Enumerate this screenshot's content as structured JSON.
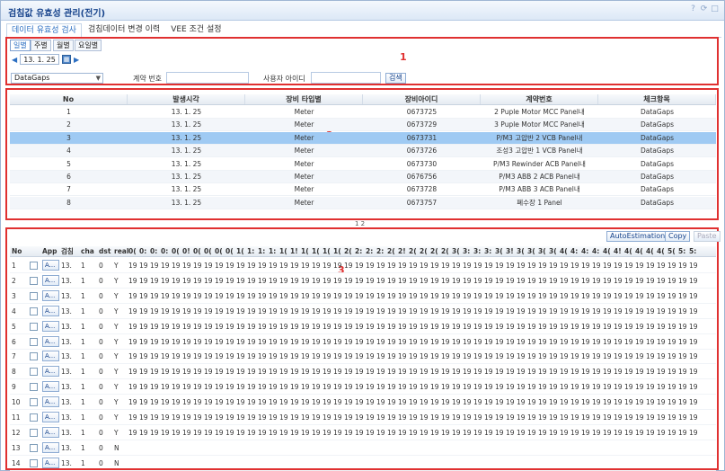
{
  "window": {
    "title": "검침값 유효성 관리(전기)"
  },
  "tabs": [
    {
      "label": "데이터 유효성 검사"
    },
    {
      "label": "검침데이터 변경 이력"
    },
    {
      "label": "VEE 조건 설정"
    }
  ],
  "section1": {
    "number": "1",
    "period_buttons": [
      "일별",
      "주별",
      "월별",
      "요일별"
    ],
    "date": "13. 1. 25",
    "check_select": "DataGaps",
    "contract_label": "계약 번호",
    "contract_value": "",
    "user_label": "사용자 아이디",
    "user_value": "",
    "search_label": "검색"
  },
  "section2": {
    "number": "2",
    "columns": [
      "No",
      "발생시각",
      "장비 타입별",
      "장비아이디",
      "계약번호",
      "체크항목"
    ],
    "rows": [
      [
        "1",
        "13. 1. 25",
        "Meter",
        "0673725",
        "2 Puple Motor MCC Panel내",
        "DataGaps"
      ],
      [
        "2",
        "13. 1. 25",
        "Meter",
        "0673729",
        "3 Puple Motor MCC Panel내",
        "DataGaps"
      ],
      [
        "3",
        "13. 1. 25",
        "Meter",
        "0673731",
        "P/M3 고압반 2 VCB Panel내",
        "DataGaps"
      ],
      [
        "4",
        "13. 1. 25",
        "Meter",
        "0673726",
        "조성3 고압반 1 VCB Panel내",
        "DataGaps"
      ],
      [
        "5",
        "13. 1. 25",
        "Meter",
        "0673730",
        "P/M3 Rewinder ACB Panel내",
        "DataGaps"
      ],
      [
        "6",
        "13. 1. 25",
        "Meter",
        "0676756",
        "P/M3 ABB 2 ACB Panel내",
        "DataGaps"
      ],
      [
        "7",
        "13. 1. 25",
        "Meter",
        "0673728",
        "P/M3 ABB 3 ACB Panel내",
        "DataGaps"
      ],
      [
        "8",
        "13. 1. 25",
        "Meter",
        "0673757",
        "폐수장 1 Panel",
        "DataGaps"
      ]
    ],
    "selected_row": 2,
    "pager": "1 2"
  },
  "section3": {
    "number": "3",
    "buttons": [
      "AutoEstimation",
      "Copy",
      "Paste"
    ],
    "fixed_columns": [
      "No",
      "",
      "App",
      "검침",
      "cha",
      "dst",
      "real"
    ],
    "hour_columns": [
      "00",
      "01",
      "02",
      "03",
      "04",
      "05",
      "06",
      "07",
      "08",
      "09",
      "10",
      "11",
      "12",
      "13",
      "14",
      "15",
      "16",
      "17",
      "18",
      "19",
      "20",
      "21",
      "22",
      "23",
      "24",
      "25",
      "26",
      "27",
      "28",
      "29",
      "30",
      "31",
      "32",
      "33",
      "34",
      "35",
      "36",
      "37",
      "38",
      "39",
      "40",
      "41",
      "42",
      "43",
      "44",
      "45",
      "46",
      "47",
      "48",
      "49",
      "50",
      "51",
      "52"
    ],
    "hour_column_labels": [
      "0(",
      "0:",
      "0:",
      "0:",
      "0(",
      "0!",
      "0(",
      "0(",
      "0(",
      "0(",
      "1(",
      "1:",
      "1:",
      "1:",
      "1(",
      "1!",
      "1(",
      "1(",
      "1(",
      "1(",
      "2(",
      "2:",
      "2:",
      "2:",
      "2(",
      "2!",
      "2(",
      "2(",
      "2(",
      "2(",
      "3(",
      "3:",
      "3:",
      "3:",
      "3(",
      "3!",
      "3(",
      "3(",
      "3(",
      "3(",
      "4(",
      "4:",
      "4:",
      "4:",
      "4(",
      "4!",
      "4(",
      "4(",
      "4(",
      "4(",
      "5(",
      "5:",
      "5:"
    ],
    "app_button": "A...",
    "rows": [
      {
        "no": "1",
        "date": "13.",
        "cha": "1",
        "dst": "0",
        "real": "Y",
        "cells": "19"
      },
      {
        "no": "2",
        "date": "13.",
        "cha": "1",
        "dst": "0",
        "real": "Y",
        "cells": "19"
      },
      {
        "no": "3",
        "date": "13.",
        "cha": "1",
        "dst": "0",
        "real": "Y",
        "cells": "19"
      },
      {
        "no": "4",
        "date": "13.",
        "cha": "1",
        "dst": "0",
        "real": "Y",
        "cells": "19"
      },
      {
        "no": "5",
        "date": "13.",
        "cha": "1",
        "dst": "0",
        "real": "Y",
        "cells": "19"
      },
      {
        "no": "6",
        "date": "13.",
        "cha": "1",
        "dst": "0",
        "real": "Y",
        "cells": "19"
      },
      {
        "no": "7",
        "date": "13.",
        "cha": "1",
        "dst": "0",
        "real": "Y",
        "cells": "19"
      },
      {
        "no": "8",
        "date": "13.",
        "cha": "1",
        "dst": "0",
        "real": "Y",
        "cells": "19"
      },
      {
        "no": "9",
        "date": "13.",
        "cha": "1",
        "dst": "0",
        "real": "Y",
        "cells": "19"
      },
      {
        "no": "10",
        "date": "13.",
        "cha": "1",
        "dst": "0",
        "real": "Y",
        "cells": "19"
      },
      {
        "no": "11",
        "date": "13.",
        "cha": "1",
        "dst": "0",
        "real": "Y",
        "cells": "19"
      },
      {
        "no": "12",
        "date": "13.",
        "cha": "1",
        "dst": "0",
        "real": "Y",
        "cells": "19"
      },
      {
        "no": "13",
        "date": "13.",
        "cha": "1",
        "dst": "0",
        "real": "N",
        "cells": ""
      },
      {
        "no": "14",
        "date": "13.",
        "cha": "1",
        "dst": "0",
        "real": "N",
        "cells": ""
      }
    ]
  },
  "colors": {
    "accent": "#2c6fc2",
    "highlight": "#e03030",
    "selected_row": "#9fcaf3"
  }
}
